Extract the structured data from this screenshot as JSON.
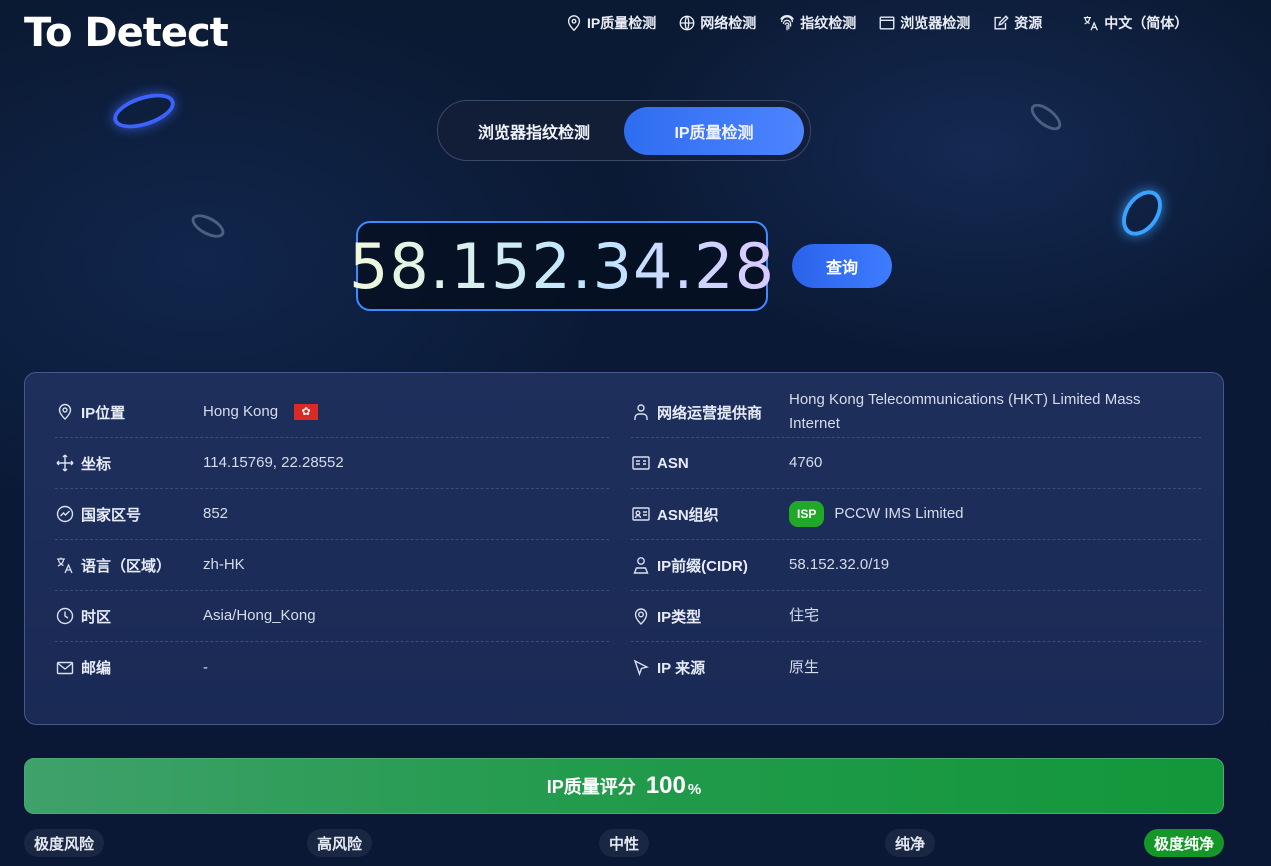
{
  "header": {
    "logo": "To Detect",
    "nav": [
      {
        "label": "IP质量检测",
        "icon": "location-pin-icon"
      },
      {
        "label": "网络检测",
        "icon": "globe-icon"
      },
      {
        "label": "指纹检测",
        "icon": "fingerprint-icon"
      },
      {
        "label": "浏览器检测",
        "icon": "browser-window-icon"
      },
      {
        "label": "资源",
        "icon": "edit-doc-icon"
      }
    ],
    "language": {
      "label": "中文（简体）",
      "icon": "translate-icon"
    }
  },
  "toggle": {
    "options": [
      "浏览器指纹检测",
      "IP质量检测"
    ],
    "active": "IP质量检测"
  },
  "search": {
    "ip": "58.152.34.28",
    "button_label": "查询"
  },
  "info": {
    "left": [
      {
        "label": "IP位置",
        "value": "Hong Kong",
        "icon": "location-pin-icon",
        "flag": "hong-kong-flag"
      },
      {
        "label": "坐标",
        "value": "114.15769, 22.28552",
        "icon": "move-arrows-icon"
      },
      {
        "label": "国家区号",
        "value": "852",
        "icon": "dial-icon"
      },
      {
        "label": "语言（区域）",
        "value": "zh-HK",
        "icon": "translate-icon"
      },
      {
        "label": "时区",
        "value": "Asia/Hong_Kong",
        "icon": "clock-icon"
      },
      {
        "label": "邮编",
        "value": "-",
        "icon": "mail-icon"
      }
    ],
    "right": [
      {
        "label": "网络运营提供商",
        "value": "Hong Kong Telecommunications (HKT) Limited Mass Internet",
        "icon": "person-icon"
      },
      {
        "label": "ASN",
        "value": "4760",
        "icon": "id-card-icon"
      },
      {
        "label": "ASN组织",
        "value": "PCCW IMS Limited",
        "icon": "org-card-icon",
        "badge": "ISP"
      },
      {
        "label": "IP前缀(CIDR)",
        "value": "58.152.32.0/19",
        "icon": "person-outline-icon"
      },
      {
        "label": "IP类型",
        "value": "住宅",
        "icon": "map-marker-icon"
      },
      {
        "label": "IP 来源",
        "value": "原生",
        "icon": "cursor-arrow-icon"
      }
    ]
  },
  "score": {
    "label": "IP质量评分",
    "value": "100",
    "unit": "%",
    "fraction": 1.0,
    "colors": {
      "start": "#3fa16b",
      "end": "#12973a"
    }
  },
  "levels": [
    {
      "label": "极度风险",
      "active": false
    },
    {
      "label": "高风险",
      "active": false
    },
    {
      "label": "中性",
      "active": false
    },
    {
      "label": "纯净",
      "active": false
    },
    {
      "label": "极度纯净",
      "active": true
    }
  ]
}
